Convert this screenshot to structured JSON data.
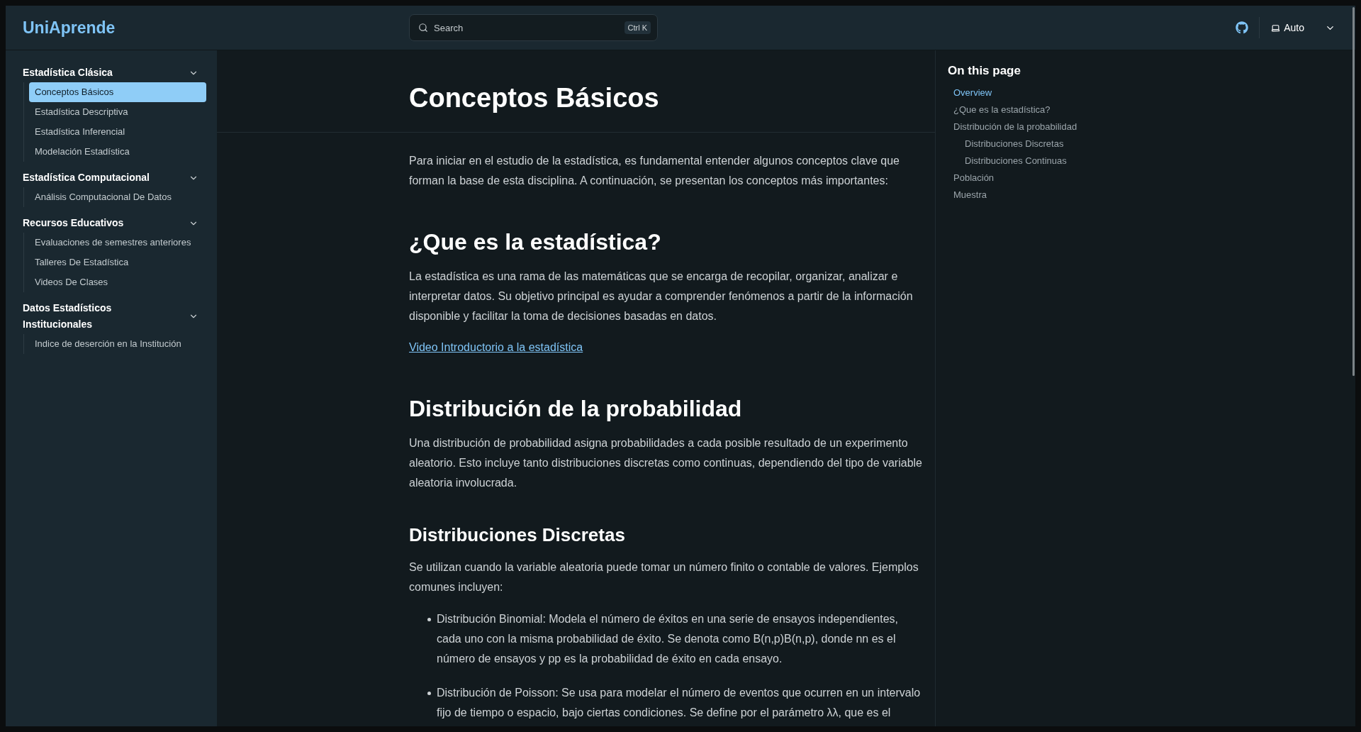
{
  "header": {
    "logo": "UniAprende",
    "search": {
      "label": "Search",
      "shortcut": "Ctrl K"
    },
    "theme": {
      "label": "Auto"
    }
  },
  "sidebar": {
    "groups": [
      {
        "title": "Estadística Clásica",
        "expanded": true,
        "items": [
          {
            "label": "Conceptos Básicos",
            "selected": true
          },
          {
            "label": "Estadística Descriptiva",
            "selected": false
          },
          {
            "label": "Estadística Inferencial",
            "selected": false
          },
          {
            "label": "Modelación Estadística",
            "selected": false
          }
        ]
      },
      {
        "title": "Estadística Computacional",
        "expanded": true,
        "items": [
          {
            "label": "Análisis Computacional De Datos",
            "selected": false
          }
        ]
      },
      {
        "title": "Recursos Educativos",
        "expanded": true,
        "items": [
          {
            "label": "Evaluaciones de semestres anteriores",
            "selected": false
          },
          {
            "label": "Talleres De Estadística",
            "selected": false
          },
          {
            "label": "Videos De Clases",
            "selected": false
          }
        ]
      },
      {
        "title": "Datos Estadísticos Institucionales",
        "expanded": true,
        "items": [
          {
            "label": "Indice de deserción en la Institución",
            "selected": false
          }
        ]
      }
    ]
  },
  "article": {
    "title": "Conceptos Básicos",
    "blocks": [
      {
        "kind": "paragraph",
        "text": "Para iniciar en el estudio de la estadística, es fundamental entender algunos conceptos clave que forman la base de esta disciplina. A continuación, se presentan los conceptos más importantes:"
      },
      {
        "kind": "heading",
        "text": "¿Que es la estadística?"
      },
      {
        "kind": "paragraph",
        "text": "La estadística es una rama de las matemáticas que se encarga de recopilar, organizar, analizar e interpretar datos. Su objetivo principal es ayudar a comprender fenómenos a partir de la información disponible y facilitar la toma de decisiones basadas en datos."
      },
      {
        "kind": "link",
        "text": "Video Introductorio a la estadística"
      },
      {
        "kind": "heading",
        "text": "Distribución de la probabilidad"
      },
      {
        "kind": "paragraph",
        "text": "Una distribución de probabilidad asigna probabilidades a cada posible resultado de un experimento aleatorio. Esto incluye tanto distribuciones discretas como continuas, dependiendo del tipo de variable aleatoria involucrada."
      },
      {
        "kind": "subheading",
        "text": "Distribuciones Discretas"
      },
      {
        "kind": "paragraph",
        "text": "Se utilizan cuando la variable aleatoria puede tomar un número finito o contable de valores. Ejemplos comunes incluyen:"
      },
      {
        "kind": "bullets",
        "items": [
          "Distribución Binomial: Modela el número de éxitos en una serie de ensayos independientes, cada uno con la misma probabilidad de éxito. Se denota como B(n,p)B(n,p), donde nn es el número de ensayos y pp es la probabilidad de éxito en cada ensayo.",
          "Distribución de Poisson: Se usa para modelar el número de eventos que ocurren en un intervalo fijo de tiempo o espacio, bajo ciertas condiciones. Se define por el parámetro λλ, que es el"
        ]
      }
    ]
  },
  "toc": {
    "title": "On this page",
    "items": [
      {
        "label": "Overview",
        "selected": true
      },
      {
        "label": "¿Que es la estadística?",
        "selected": false
      },
      {
        "label": "Distribución de la probabilidad",
        "selected": false,
        "children": [
          {
            "label": "Distribuciones Discretas",
            "selected": false
          },
          {
            "label": "Distribuciones Continuas",
            "selected": false
          }
        ]
      },
      {
        "label": "Población",
        "selected": false
      },
      {
        "label": "Muestra",
        "selected": false
      }
    ]
  }
}
